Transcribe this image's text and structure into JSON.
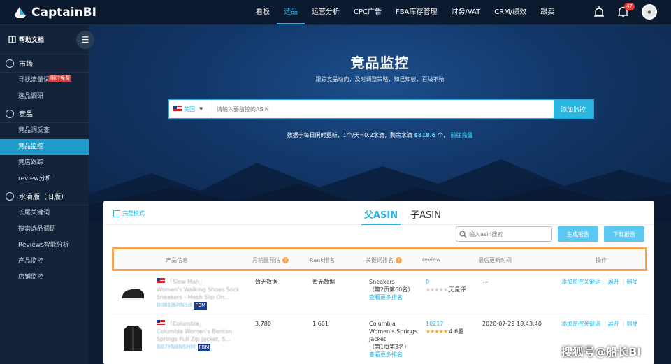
{
  "app": {
    "name": "CaptainBI"
  },
  "nav": [
    {
      "label": "看板",
      "active": false
    },
    {
      "label": "选品",
      "active": true
    },
    {
      "label": "运营分析",
      "active": false
    },
    {
      "label": "CPC广告",
      "active": false
    },
    {
      "label": "FBA库存管理",
      "active": false
    },
    {
      "label": "财务/VAT",
      "active": false
    },
    {
      "label": "CRM/绩效",
      "active": false
    },
    {
      "label": "跟卖",
      "active": false
    }
  ],
  "notification_count": "47",
  "sidebar": {
    "help_label": "帮助文档",
    "sections": [
      {
        "label": "市场",
        "items": [
          {
            "label": "寻找流量词",
            "tag": "限时免费"
          },
          {
            "label": "选品调研"
          }
        ]
      },
      {
        "label": "竞品",
        "items": [
          {
            "label": "竞品词反查"
          },
          {
            "label": "竞品监控",
            "active": true
          },
          {
            "label": "竞店跟踪"
          },
          {
            "label": "review分析"
          }
        ]
      },
      {
        "label": "水滴版（旧版）",
        "items": [
          {
            "label": "长尾关键词"
          },
          {
            "label": "搜索选品调研"
          },
          {
            "label": "Reviews智能分析"
          },
          {
            "label": "产品监控"
          },
          {
            "label": "店铺监控"
          }
        ]
      }
    ]
  },
  "hero": {
    "title": "竞品监控",
    "subtitle": "跟踪竞品动向，及时调整策略，知己知彼，百战不殆",
    "country": "美国",
    "search_placeholder": "请输入要监控的ASIN",
    "add_button": "添加监控",
    "note_prefix": "数据于每日闲时更新，1个/天=0.2水滴，剩余水滴",
    "note_balance": "$818.6",
    "note_unit": "个，",
    "note_link": "前往充值"
  },
  "panel": {
    "simple_mode": "完整模式",
    "tabs": [
      "父ASIN",
      "子ASIN"
    ],
    "asin_search_placeholder": "输入asin搜索",
    "gen_report": "生成报告",
    "download_report": "下载报告",
    "columns": [
      "产品信息",
      "月销量预估",
      "Rank排名",
      "关键词排名",
      "review",
      "最后更新时间",
      "操作"
    ],
    "rows": [
      {
        "brand": "「Slow Man」",
        "title": "Women's Walking Shoes Sock Sneakers - Mesh Slip On...",
        "asin": "B081J6RN5B",
        "fulfill": "FBM",
        "monthly_sales": "暂无数据",
        "rank": "暂无数据",
        "keyword": "Sneakers",
        "keyword_pos": "（第2页第60名）",
        "more_rank": "查看更多排名",
        "review_count": "0",
        "review_stars": 0,
        "review_text": "无星评",
        "updated": "---",
        "ops": [
          "添加监控关键词",
          "展开",
          "删除"
        ]
      },
      {
        "brand": "「Columbia」",
        "title": "Columbia Women's Benton Springs Full Zip Jacket, S...",
        "asin": "B07YN8NSHM",
        "fulfill": "FBM",
        "monthly_sales": "3,780",
        "rank": "1,661",
        "keyword": "Columbia Women's Springs Jacket",
        "keyword_pos": "（第1页第3名）",
        "more_rank": "查看更多排名",
        "review_count": "10217",
        "review_stars": 4.6,
        "review_text": "4.6星",
        "updated": "2020-07-29 18:43:40",
        "ops": [
          "添加监控关键词",
          "展开",
          "删除"
        ]
      }
    ]
  },
  "watermark": "搜狐号@船长BI",
  "colors": {
    "accent": "#29b6e0",
    "highlight_border": "#f5a352",
    "sidebar_bg": "#13243a",
    "topbar_bg": "#0b1a2e"
  }
}
